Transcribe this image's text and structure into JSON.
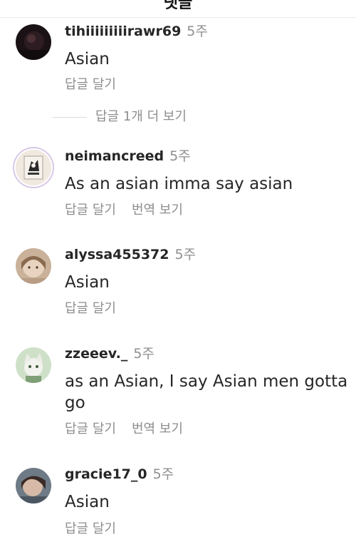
{
  "header": {
    "title": "댓글"
  },
  "comments": [
    {
      "username": "tihiiiiiiiiirawr69",
      "time": "5주",
      "text": "Asian",
      "reply_label": "답글 달기"
    },
    {
      "username": "neimancreed",
      "time": "5주",
      "text": "As an asian imma say asian",
      "reply_label": "답글 달기",
      "translate_label": "번역 보기"
    },
    {
      "username": "alyssa455372",
      "time": "5주",
      "text": "Asian",
      "reply_label": "답글 달기"
    },
    {
      "username": "zzeeev._",
      "time": "5주",
      "text": "as an Asian, I say Asian men gotta go",
      "reply_label": "답글 달기",
      "translate_label": "번역 보기"
    },
    {
      "username": "gracie17_0",
      "time": "5주",
      "text": "Asian",
      "reply_label": "답글 달기"
    }
  ],
  "view_replies": {
    "label": "답글 1개 더 보기"
  },
  "colors": {
    "text": "#262626",
    "secondary": "#8e8e8e",
    "divider": "#dbdbdb"
  }
}
